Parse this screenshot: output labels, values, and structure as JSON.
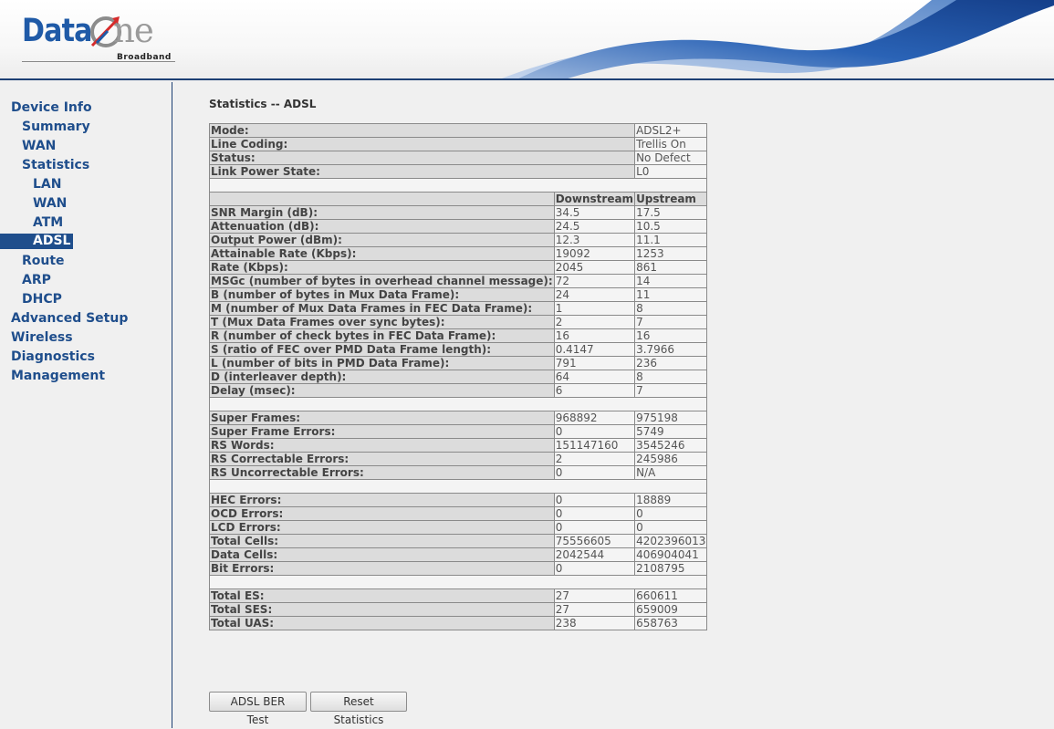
{
  "header": {
    "logo_data": "Data",
    "logo_one": "ne",
    "logo_sub": "Broadband"
  },
  "sidebar": {
    "items": [
      {
        "label": "Device Info"
      },
      {
        "label": "Summary"
      },
      {
        "label": "WAN"
      },
      {
        "label": "Statistics"
      },
      {
        "label": "LAN"
      },
      {
        "label": "WAN"
      },
      {
        "label": "ATM"
      },
      {
        "label": "ADSL"
      },
      {
        "label": "Route"
      },
      {
        "label": "ARP"
      },
      {
        "label": "DHCP"
      },
      {
        "label": "Advanced Setup"
      },
      {
        "label": "Wireless"
      },
      {
        "label": "Diagnostics"
      },
      {
        "label": "Management"
      }
    ],
    "active": "ADSL"
  },
  "main": {
    "title": "Statistics -- ADSL",
    "status": [
      {
        "label": "Mode:",
        "value": "ADSL2+"
      },
      {
        "label": "Line Coding:",
        "value": "Trellis On"
      },
      {
        "label": "Status:",
        "value": "No Defect"
      },
      {
        "label": "Link Power State:",
        "value": "L0"
      }
    ],
    "columns": {
      "down": "Downstream",
      "up": "Upstream"
    },
    "groups": [
      [
        {
          "label": "SNR Margin (dB):",
          "down": "34.5",
          "up": "17.5"
        },
        {
          "label": "Attenuation (dB):",
          "down": "24.5",
          "up": "10.5"
        },
        {
          "label": "Output Power (dBm):",
          "down": "12.3",
          "up": "11.1"
        },
        {
          "label": "Attainable Rate (Kbps):",
          "down": "19092",
          "up": "1253"
        },
        {
          "label": "Rate (Kbps):",
          "down": "2045",
          "up": "861"
        },
        {
          "label": "MSGc (number of bytes in overhead channel message):",
          "down": "72",
          "up": "14"
        },
        {
          "label": "B (number of bytes in Mux Data Frame):",
          "down": "24",
          "up": "11"
        },
        {
          "label": "M (number of Mux Data Frames in FEC Data Frame):",
          "down": "1",
          "up": "8"
        },
        {
          "label": "T (Mux Data Frames over sync bytes):",
          "down": "2",
          "up": "7"
        },
        {
          "label": "R (number of check bytes in FEC Data Frame):",
          "down": "16",
          "up": "16"
        },
        {
          "label": "S (ratio of FEC over PMD Data Frame length):",
          "down": "0.4147",
          "up": "3.7966"
        },
        {
          "label": "L (number of bits in PMD Data Frame):",
          "down": "791",
          "up": "236"
        },
        {
          "label": "D (interleaver depth):",
          "down": "64",
          "up": "8"
        },
        {
          "label": "Delay (msec):",
          "down": "6",
          "up": "7"
        }
      ],
      [
        {
          "label": "Super Frames:",
          "down": "968892",
          "up": "975198"
        },
        {
          "label": "Super Frame Errors:",
          "down": "0",
          "up": "5749"
        },
        {
          "label": "RS Words:",
          "down": "151147160",
          "up": "3545246"
        },
        {
          "label": "RS Correctable Errors:",
          "down": "2",
          "up": "245986"
        },
        {
          "label": "RS Uncorrectable Errors:",
          "down": "0",
          "up": "N/A"
        }
      ],
      [
        {
          "label": "HEC Errors:",
          "down": "0",
          "up": "18889"
        },
        {
          "label": "OCD Errors:",
          "down": "0",
          "up": "0"
        },
        {
          "label": "LCD Errors:",
          "down": "0",
          "up": "0"
        },
        {
          "label": "Total Cells:",
          "down": "75556605",
          "up": "4202396013"
        },
        {
          "label": "Data Cells:",
          "down": "2042544",
          "up": "406904041"
        },
        {
          "label": "Bit Errors:",
          "down": "0",
          "up": "2108795"
        }
      ],
      [
        {
          "label": "Total ES:",
          "down": "27",
          "up": "660611"
        },
        {
          "label": "Total SES:",
          "down": "27",
          "up": "659009"
        },
        {
          "label": "Total UAS:",
          "down": "238",
          "up": "658763"
        }
      ]
    ],
    "buttons": {
      "ber_test": "ADSL BER Test",
      "reset": "Reset Statistics"
    }
  },
  "colors": {
    "brand_blue": "#1f5aa7",
    "nav_blue": "#1f4e8c",
    "header_rule": "#1c3f73",
    "active_nav_bg": "#1f4e8c"
  },
  "icons": [
    "dataone-logo-mark",
    "header-swoosh"
  ]
}
